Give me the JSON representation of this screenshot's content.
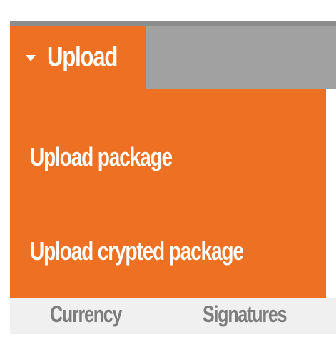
{
  "upload_menu": {
    "label": "Upload",
    "items": [
      {
        "label": "Upload package"
      },
      {
        "label": "Upload crypted package"
      }
    ]
  },
  "background_tabs": [
    {
      "label": "Currency"
    },
    {
      "label": "Signatures"
    }
  ],
  "colors": {
    "accent": "#ee7023",
    "toolbar": "#a1a1a1",
    "menu_text": "#ffffff",
    "inactive_tab_text": "#7d7d7d"
  },
  "icons": {
    "menu_toggle": "caret-down-icon"
  }
}
